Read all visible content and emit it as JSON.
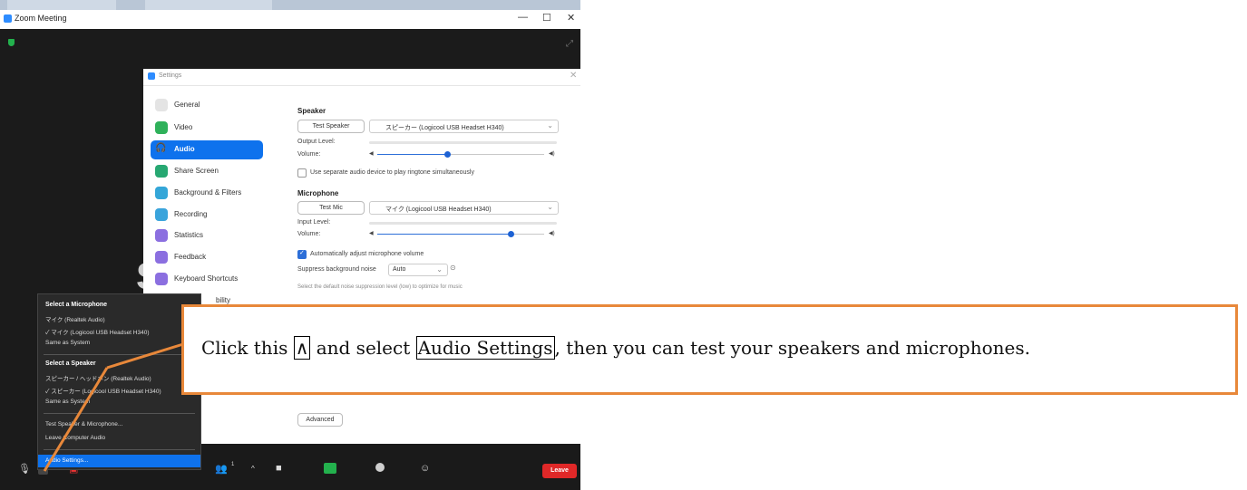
{
  "zoom_window": {
    "title": "Zoom Meeting",
    "minimize": "—",
    "maximize": "☐",
    "close": "✕"
  },
  "background_text": "S",
  "settings": {
    "title": "Settings",
    "close": "✕",
    "nav": [
      {
        "label": "General",
        "icon": "gear-icon",
        "color": "#e4e4e4",
        "active": false
      },
      {
        "label": "Video",
        "icon": "video-icon",
        "color": "#2fb15a",
        "active": false
      },
      {
        "label": "Audio",
        "icon": "headphones-icon",
        "color": "#0e72ed",
        "active": true
      },
      {
        "label": "Share Screen",
        "icon": "share-screen-icon",
        "color": "#27a872",
        "active": false
      },
      {
        "label": "Background & Filters",
        "icon": "background-icon",
        "color": "#34a6d8",
        "active": false
      },
      {
        "label": "Recording",
        "icon": "recording-icon",
        "color": "#3aa4dc",
        "active": false
      },
      {
        "label": "Statistics",
        "icon": "statistics-icon",
        "color": "#8b6fe0",
        "active": false
      },
      {
        "label": "Feedback",
        "icon": "feedback-icon",
        "color": "#8b6fe0",
        "active": false
      },
      {
        "label": "Keyboard Shortcuts",
        "icon": "keyboard-icon",
        "color": "#8b6fe0",
        "active": false
      },
      {
        "label": "bility",
        "icon": "accessibility-icon",
        "color": "#8b6fe0",
        "active": false
      }
    ],
    "speaker": {
      "heading": "Speaker",
      "test_button": "Test Speaker",
      "device": "スピーカー (Logicool USB Headset H340)",
      "output_level_label": "Output Level:",
      "volume_label": "Volume:",
      "volume": 0.42,
      "ringtone_checkbox": "Use separate audio device to play ringtone simultaneously"
    },
    "microphone": {
      "heading": "Microphone",
      "test_button": "Test Mic",
      "device": "マイク (Logicool USB Headset H340)",
      "input_level_label": "Input Level:",
      "volume_label": "Volume:",
      "volume": 0.8,
      "auto_adjust_checkbox": "Automatically adjust microphone volume",
      "suppress_label": "Suppress background noise",
      "suppress_value": "Auto",
      "hint": "Select the default noise suppression level (low) to optimize for music"
    },
    "advanced_button": "Advanced"
  },
  "audio_menu": {
    "mic_heading": "Select a Microphone",
    "mic_items": [
      "マイク (Realtek Audio)",
      "✓  マイク (Logicool USB Headset H340)",
      "Same as System"
    ],
    "speaker_heading": "Select a Speaker",
    "speaker_items": [
      "スピーカー / ヘッドホン (Realtek Audio)",
      "✓  スピーカー (Logicool USB Headset H340)",
      "Same as System"
    ],
    "test_item": "Test Speaker & Microphone...",
    "leave_audio_item": "Leave Computer Audio",
    "audio_settings_item": "Audio Settings..."
  },
  "toolbar": {
    "participants_count": "1",
    "leave": "Leave"
  },
  "callout": {
    "part1": "Click this ",
    "caret": "∧",
    "part2": " and select ",
    "boxed": "Audio Settings",
    "part3": ", then you can test your speakers and microphones."
  },
  "colors": {
    "accent": "#0e72ed",
    "callout_border": "#e8883a",
    "leave": "#e02828"
  }
}
